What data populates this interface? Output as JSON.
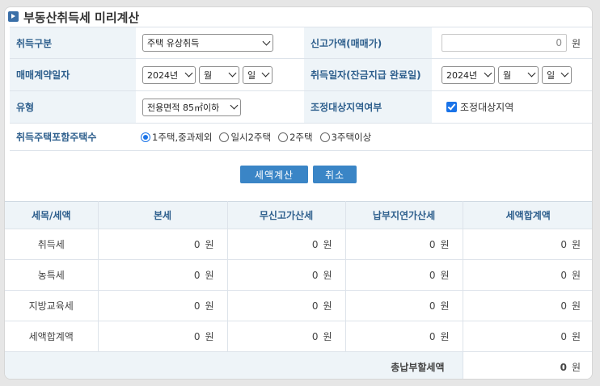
{
  "title": "부동산취득세 미리계산",
  "form": {
    "acq_type_label": "취득구분",
    "acq_type_value": "주택 유상취득",
    "report_price_label": "신고가액(매매가)",
    "report_price_value": "0",
    "won": "원",
    "contract_date_label": "매매계약일자",
    "acq_date_label": "취득일자(잔금지급 완료일)",
    "year": "2024년",
    "month": "월",
    "day": "일",
    "type_label": "유형",
    "type_value": "전용면적 85㎡이하",
    "adjust_label": "조정대상지역여부",
    "adjust_check_label": "조정대상지역",
    "adjust_checked": true,
    "house_count_label": "취득주택포함주택수",
    "house_count_options": [
      "1주택,중과제외",
      "일시2주택",
      "2주택",
      "3주택이상"
    ],
    "house_count_selected": 0
  },
  "buttons": {
    "calc": "세액계산",
    "cancel": "취소"
  },
  "result": {
    "headers": [
      "세목/세액",
      "본세",
      "무신고가산세",
      "납부지연가산세",
      "세액합계액"
    ],
    "rows": [
      {
        "name": "취득세",
        "values": [
          "0",
          "0",
          "0",
          "0"
        ]
      },
      {
        "name": "농특세",
        "values": [
          "0",
          "0",
          "0",
          "0"
        ]
      },
      {
        "name": "지방교육세",
        "values": [
          "0",
          "0",
          "0",
          "0"
        ]
      },
      {
        "name": "세액합계액",
        "values": [
          "0",
          "0",
          "0",
          "0"
        ]
      }
    ],
    "total_label": "총납부할세액",
    "total_value": "0",
    "unit": "원"
  },
  "colors": {
    "accent": "#3a85c6",
    "label_bg": "#eef4f8",
    "label_text": "#2e5f8d"
  }
}
